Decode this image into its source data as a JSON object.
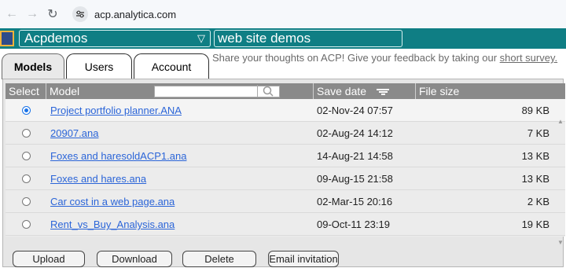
{
  "browser": {
    "url": "acp.analytica.com"
  },
  "header": {
    "model_select_value": "Acpdemos",
    "demo_title": "web site demos"
  },
  "tabs": [
    {
      "label": "Models",
      "active": true
    },
    {
      "label": "Users",
      "active": false
    },
    {
      "label": "Account",
      "active": false
    }
  ],
  "feedback": {
    "text": "Share your thoughts on ACP! Give your feedback by taking our ",
    "link_text": "short survey."
  },
  "table": {
    "columns": [
      "Select",
      "Model",
      "Save date",
      "File size"
    ],
    "search_value": "",
    "rows": [
      {
        "selected": true,
        "model": "Project portfolio planner.ANA",
        "date": "02-Nov-24 07:57",
        "size": "89 KB"
      },
      {
        "selected": false,
        "model": "20907.ana",
        "date": "02-Aug-24 14:12",
        "size": "7 KB"
      },
      {
        "selected": false,
        "model": "Foxes and haresoldACP1.ana",
        "date": "14-Aug-21 14:58",
        "size": "13 KB"
      },
      {
        "selected": false,
        "model": "Foxes and hares.ana",
        "date": "09-Aug-15 21:58",
        "size": "13 KB"
      },
      {
        "selected": false,
        "model": "Car cost in a web page.ana",
        "date": "02-Mar-15 20:16",
        "size": "2 KB"
      },
      {
        "selected": false,
        "model": "Rent_vs_Buy_Analysis.ana",
        "date": "09-Oct-11 23:19",
        "size": "19 KB"
      }
    ]
  },
  "buttons": {
    "upload": "Upload",
    "download": "Download",
    "delete": "Delete",
    "email": "Email invitation"
  },
  "icons": {
    "back": "arrow-left-icon",
    "forward": "arrow-right-icon",
    "reload": "reload-icon",
    "site_settings": "tune-icon",
    "logo": "app-logo-icon",
    "chevron": "chevron-down-icon",
    "search": "search-icon",
    "sort": "sort-icon"
  },
  "colors": {
    "header_bg": "#0f7e84",
    "table_header_bg": "#8a8a8a",
    "link": "#2b65d8",
    "selected_radio": "#1a73e8"
  }
}
